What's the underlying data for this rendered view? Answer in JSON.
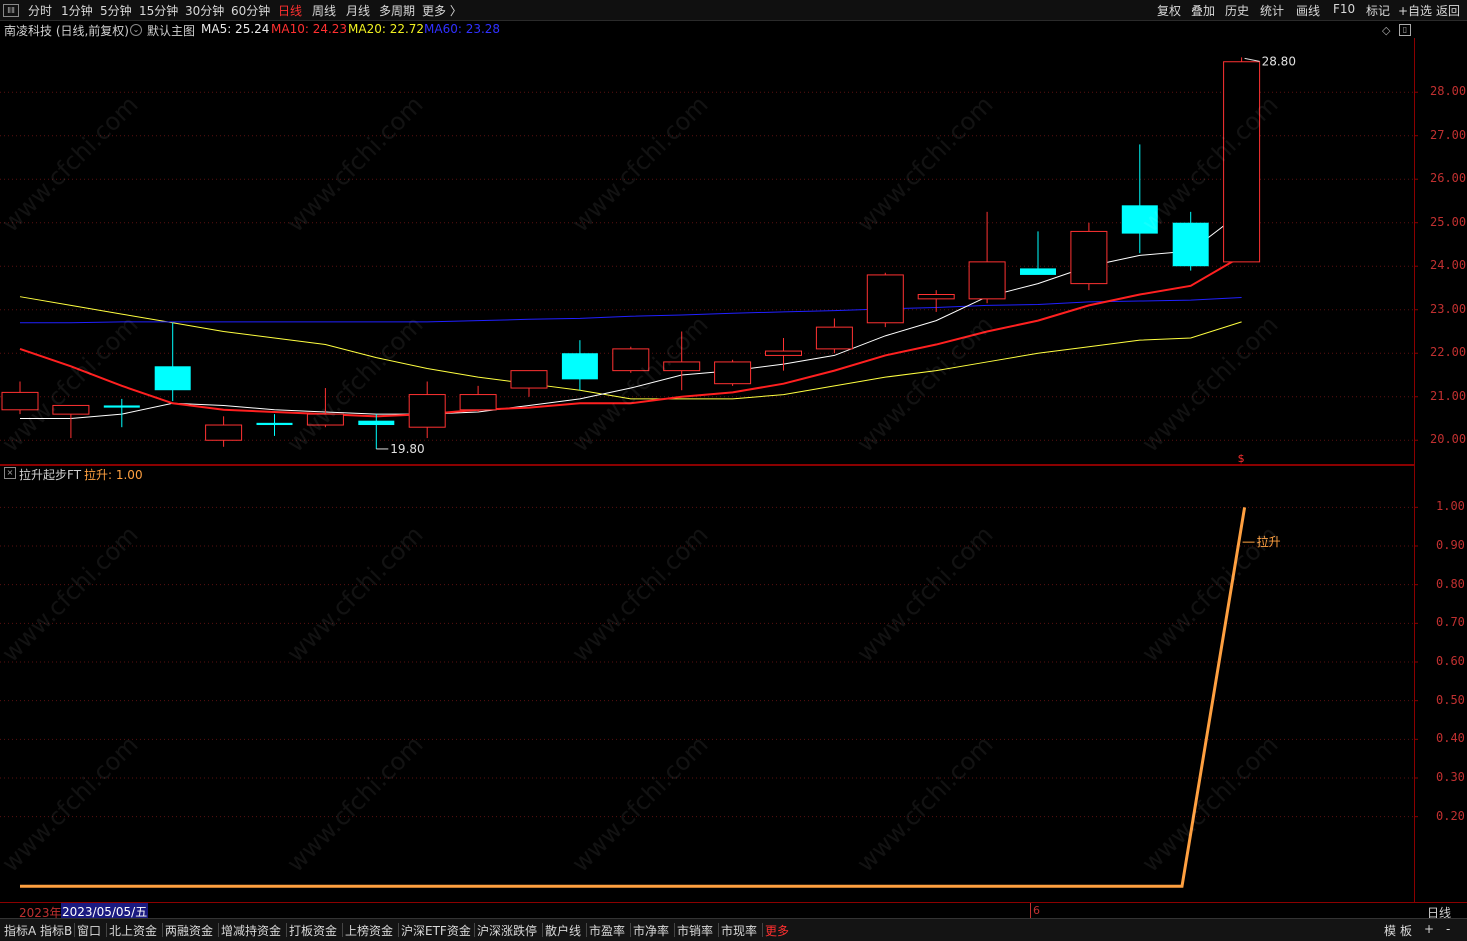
{
  "topbar": {
    "periods": [
      "分时",
      "1分钟",
      "5分钟",
      "15分钟",
      "30分钟",
      "60分钟",
      "日线",
      "周线",
      "月线",
      "多周期",
      "更多 〉"
    ],
    "active_period": "日线",
    "right_buttons": [
      "复权",
      "叠加",
      "历史",
      "统计",
      "画线",
      "F10",
      "标记",
      "+自选",
      "返回"
    ]
  },
  "main_chart": {
    "title": "南凌科技 (日线,前复权)",
    "indicator_name": "默认主图",
    "ma5": "MA5: 25.24",
    "ma10": "MA10: 24.23",
    "ma20": "MA20: 22.72",
    "ma60": "MA60: 23.28",
    "high_label": "28.80",
    "low_label": "19.80",
    "marker_label": "$",
    "y_ticks": [
      "28.00",
      "27.00",
      "26.00",
      "25.00",
      "24.00",
      "23.00",
      "22.00",
      "21.00",
      "20.00"
    ],
    "colors": {
      "up": "#ff3232",
      "down": "#00ffff",
      "ma5": "#ffffff",
      "ma10": "#ff2020",
      "ma20": "#ffff40",
      "ma60": "#2020ff"
    }
  },
  "sub_chart": {
    "indicator_name": "拉升起步FT",
    "value_label": "拉升: 1.00",
    "line_label": "拉升",
    "y_ticks": [
      "1.00",
      "0.90",
      "0.80",
      "0.70",
      "0.60",
      "0.50",
      "0.40",
      "0.30",
      "0.20"
    ],
    "line_color": "#ffa040"
  },
  "date_bar": {
    "year": "2023年",
    "date": "2023/05/05/五",
    "month_marker": "6",
    "period_label": "日线"
  },
  "watermark": "www.cfchi.com",
  "bottombar": {
    "tabs": [
      "指标A",
      "指标B",
      "窗口",
      "北上资金",
      "两融资金",
      "增减持资金",
      "打板资金",
      "上榜资金",
      "沪深ETF资金",
      "沪深涨跌停",
      "散户线",
      "市盈率",
      "市净率",
      "市销率",
      "市现率",
      "更多"
    ],
    "right": [
      "模",
      "板",
      "+",
      "-"
    ]
  },
  "chart_data": {
    "type": "candlestick",
    "candles": [
      {
        "o": 20.7,
        "h": 21.35,
        "l": 20.6,
        "c": 21.1
      },
      {
        "o": 20.6,
        "h": 20.8,
        "l": 20.05,
        "c": 20.8
      },
      {
        "o": 20.8,
        "h": 20.95,
        "l": 20.3,
        "c": 20.75
      },
      {
        "o": 21.7,
        "h": 22.7,
        "l": 20.9,
        "c": 21.15
      },
      {
        "o": 20.0,
        "h": 20.55,
        "l": 19.85,
        "c": 20.35
      },
      {
        "o": 20.4,
        "h": 20.6,
        "l": 20.1,
        "c": 20.35
      },
      {
        "o": 20.35,
        "h": 21.2,
        "l": 20.3,
        "c": 20.6
      },
      {
        "o": 20.45,
        "h": 20.6,
        "l": 19.8,
        "c": 20.35
      },
      {
        "o": 20.3,
        "h": 21.35,
        "l": 20.05,
        "c": 21.05
      },
      {
        "o": 20.7,
        "h": 21.25,
        "l": 20.65,
        "c": 21.05
      },
      {
        "o": 21.2,
        "h": 21.6,
        "l": 21.0,
        "c": 21.6
      },
      {
        "o": 22.0,
        "h": 22.3,
        "l": 21.15,
        "c": 21.4
      },
      {
        "o": 21.6,
        "h": 22.15,
        "l": 21.55,
        "c": 22.1
      },
      {
        "o": 21.6,
        "h": 22.5,
        "l": 21.15,
        "c": 21.8
      },
      {
        "o": 21.3,
        "h": 21.85,
        "l": 21.25,
        "c": 21.8
      },
      {
        "o": 21.95,
        "h": 22.35,
        "l": 21.6,
        "c": 22.05
      },
      {
        "o": 22.1,
        "h": 22.8,
        "l": 22.0,
        "c": 22.6
      },
      {
        "o": 22.7,
        "h": 23.85,
        "l": 22.6,
        "c": 23.8
      },
      {
        "o": 23.25,
        "h": 23.45,
        "l": 22.95,
        "c": 23.35
      },
      {
        "o": 23.25,
        "h": 25.25,
        "l": 23.15,
        "c": 24.1
      },
      {
        "o": 23.95,
        "h": 24.8,
        "l": 23.85,
        "c": 23.8
      },
      {
        "o": 23.6,
        "h": 25.0,
        "l": 23.45,
        "c": 24.8
      },
      {
        "o": 25.4,
        "h": 26.8,
        "l": 24.3,
        "c": 24.75
      },
      {
        "o": 25.0,
        "h": 25.25,
        "l": 23.9,
        "c": 24.0
      },
      {
        "o": 24.1,
        "h": 28.8,
        "l": 24.1,
        "c": 28.7
      }
    ],
    "ma5": [
      20.5,
      20.5,
      20.6,
      20.85,
      20.8,
      20.7,
      20.65,
      20.6,
      20.6,
      20.65,
      20.8,
      20.95,
      21.2,
      21.5,
      21.6,
      21.75,
      21.95,
      22.4,
      22.75,
      23.3,
      23.6,
      24.0,
      24.25,
      24.35,
      25.24
    ],
    "ma10": [
      22.1,
      21.7,
      21.25,
      20.85,
      20.7,
      20.65,
      20.6,
      20.55,
      20.6,
      20.7,
      20.75,
      20.85,
      20.85,
      21.0,
      21.1,
      21.3,
      21.6,
      21.95,
      22.2,
      22.5,
      22.75,
      23.1,
      23.35,
      23.55,
      24.23
    ],
    "ma20": [
      23.3,
      23.1,
      22.9,
      22.7,
      22.5,
      22.35,
      22.2,
      21.9,
      21.65,
      21.45,
      21.3,
      21.15,
      20.95,
      20.95,
      20.95,
      21.05,
      21.25,
      21.45,
      21.6,
      21.8,
      22.0,
      22.15,
      22.3,
      22.35,
      22.72
    ],
    "ma60": [
      22.7,
      22.7,
      22.72,
      22.72,
      22.72,
      22.72,
      22.72,
      22.72,
      22.72,
      22.75,
      22.78,
      22.8,
      22.85,
      22.88,
      22.92,
      22.95,
      22.98,
      23.02,
      23.05,
      23.1,
      23.12,
      23.18,
      23.2,
      23.22,
      23.28
    ],
    "main_ylim": [
      19.5,
      29.2
    ],
    "sub_series": {
      "name": "拉升",
      "values": [
        0.02,
        0.02,
        0.02,
        0.02,
        0.02,
        0.02,
        0.02,
        0.02,
        0.02,
        0.02,
        0.02,
        0.02,
        0.02,
        0.02,
        0.02,
        0.02,
        0.02,
        0.02,
        0.02,
        0.02,
        0.02,
        0.02,
        0.02,
        0.02,
        0.02,
        0.02,
        0.02,
        0.02,
        0.02,
        0.02,
        0.02,
        0.02,
        0.02,
        0.02,
        0.02,
        0.02,
        0.02,
        0.02,
        0.02,
        0.02,
        0.02,
        0.02,
        0.02,
        0.02,
        0.02,
        0.02,
        0.02,
        1.0
      ]
    },
    "sub_ylim": [
      0.0,
      1.05
    ]
  }
}
